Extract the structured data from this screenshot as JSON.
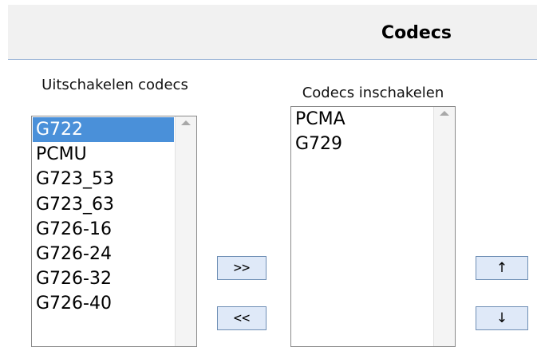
{
  "header": {
    "title": "Codecs"
  },
  "disabled_codecs": {
    "caption": "Uitschakelen codecs",
    "items": [
      "G722",
      "PCMU",
      "G723_53",
      "G723_63",
      "G726-16",
      "G726-24",
      "G726-32",
      "G726-40"
    ],
    "selected": "G722"
  },
  "enabled_codecs": {
    "caption": "Codecs inschakelen",
    "items": [
      "PCMA",
      "G729"
    ]
  },
  "buttons": {
    "add": ">>",
    "remove": "<<",
    "move_up": "↑",
    "move_down": "↓"
  },
  "colors": {
    "selection": "#4a90d9",
    "button_bg": "#dfe9f8",
    "header_bg": "#f1f1f1",
    "header_rule": "#9bb4d6"
  },
  "icons": {
    "scroll_up": "scroll-up-arrow-icon"
  }
}
